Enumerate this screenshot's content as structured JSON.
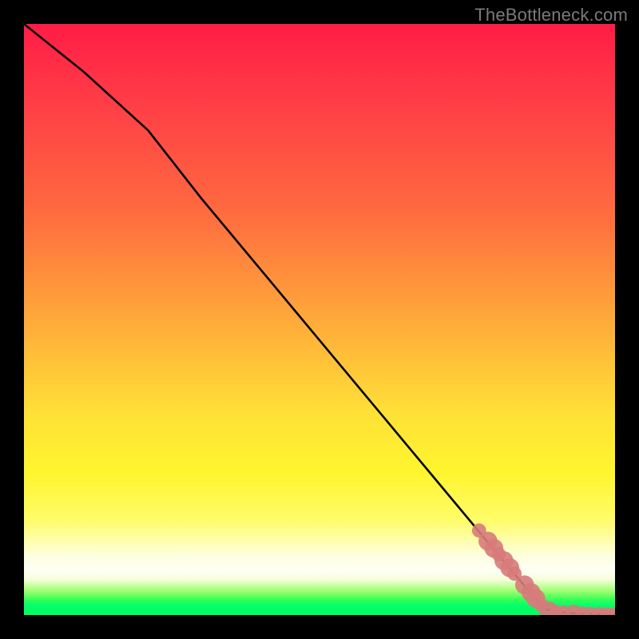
{
  "watermark": "TheBottleneck.com",
  "chart_data": {
    "type": "line",
    "title": "",
    "xlabel": "",
    "ylabel": "",
    "xlim": [
      0,
      100
    ],
    "ylim": [
      0,
      100
    ],
    "grid": false,
    "background_gradient": [
      {
        "stop": 0,
        "color": "#ff1c45"
      },
      {
        "stop": 12,
        "color": "#ff3a47"
      },
      {
        "stop": 32,
        "color": "#ff6b3f"
      },
      {
        "stop": 52,
        "color": "#ffb039"
      },
      {
        "stop": 66,
        "color": "#ffe137"
      },
      {
        "stop": 76,
        "color": "#fff52e"
      },
      {
        "stop": 84,
        "color": "#fffc6a"
      },
      {
        "stop": 90,
        "color": "#fdffe0"
      },
      {
        "stop": 92.5,
        "color": "#fffff5"
      },
      {
        "stop": 94,
        "color": "#f5ffd9"
      },
      {
        "stop": 96,
        "color": "#9bff6e"
      },
      {
        "stop": 97.5,
        "color": "#2fff57"
      },
      {
        "stop": 98.5,
        "color": "#00ff6b"
      },
      {
        "stop": 100,
        "color": "#00ff5a"
      }
    ],
    "series": [
      {
        "name": "black-line",
        "type": "line",
        "color": "#000000",
        "x": [
          0,
          10,
          21,
          30,
          40,
          50,
          60,
          70,
          80,
          88,
          91,
          93,
          95,
          97,
          99,
          100
        ],
        "y": [
          100,
          92,
          82,
          70.5,
          58.5,
          46.5,
          34.5,
          22.5,
          10.5,
          1.0,
          0.5,
          0.3,
          0.2,
          0.15,
          0.1,
          0.1
        ]
      },
      {
        "name": "pink-blobs",
        "type": "scatter",
        "color": "#d77b7b",
        "points": [
          {
            "x": 77.0,
            "y": 14.3,
            "r": 1.2
          },
          {
            "x": 78.5,
            "y": 12.5,
            "r": 1.6
          },
          {
            "x": 79.5,
            "y": 11.3,
            "r": 1.6
          },
          {
            "x": 80.3,
            "y": 10.3,
            "r": 1.2
          },
          {
            "x": 81.2,
            "y": 9.2,
            "r": 1.6
          },
          {
            "x": 82.2,
            "y": 8.0,
            "r": 1.6
          },
          {
            "x": 83.0,
            "y": 7.0,
            "r": 1.2
          },
          {
            "x": 84.7,
            "y": 5.1,
            "r": 1.6
          },
          {
            "x": 85.8,
            "y": 3.8,
            "r": 1.6
          },
          {
            "x": 86.6,
            "y": 2.8,
            "r": 1.6
          },
          {
            "x": 87.5,
            "y": 1.7,
            "r": 1.2
          },
          {
            "x": 88.8,
            "y": 0.7,
            "r": 1.6
          },
          {
            "x": 90.0,
            "y": 0.5,
            "r": 1.2
          },
          {
            "x": 91.3,
            "y": 0.45,
            "r": 1.2
          },
          {
            "x": 93.0,
            "y": 0.35,
            "r": 1.4
          },
          {
            "x": 94.5,
            "y": 0.25,
            "r": 1.2
          },
          {
            "x": 95.8,
            "y": 0.2,
            "r": 1.2
          },
          {
            "x": 97.3,
            "y": 0.15,
            "r": 1.2
          },
          {
            "x": 98.6,
            "y": 0.12,
            "r": 1.2
          },
          {
            "x": 99.8,
            "y": 0.1,
            "r": 1.2
          }
        ]
      }
    ]
  }
}
